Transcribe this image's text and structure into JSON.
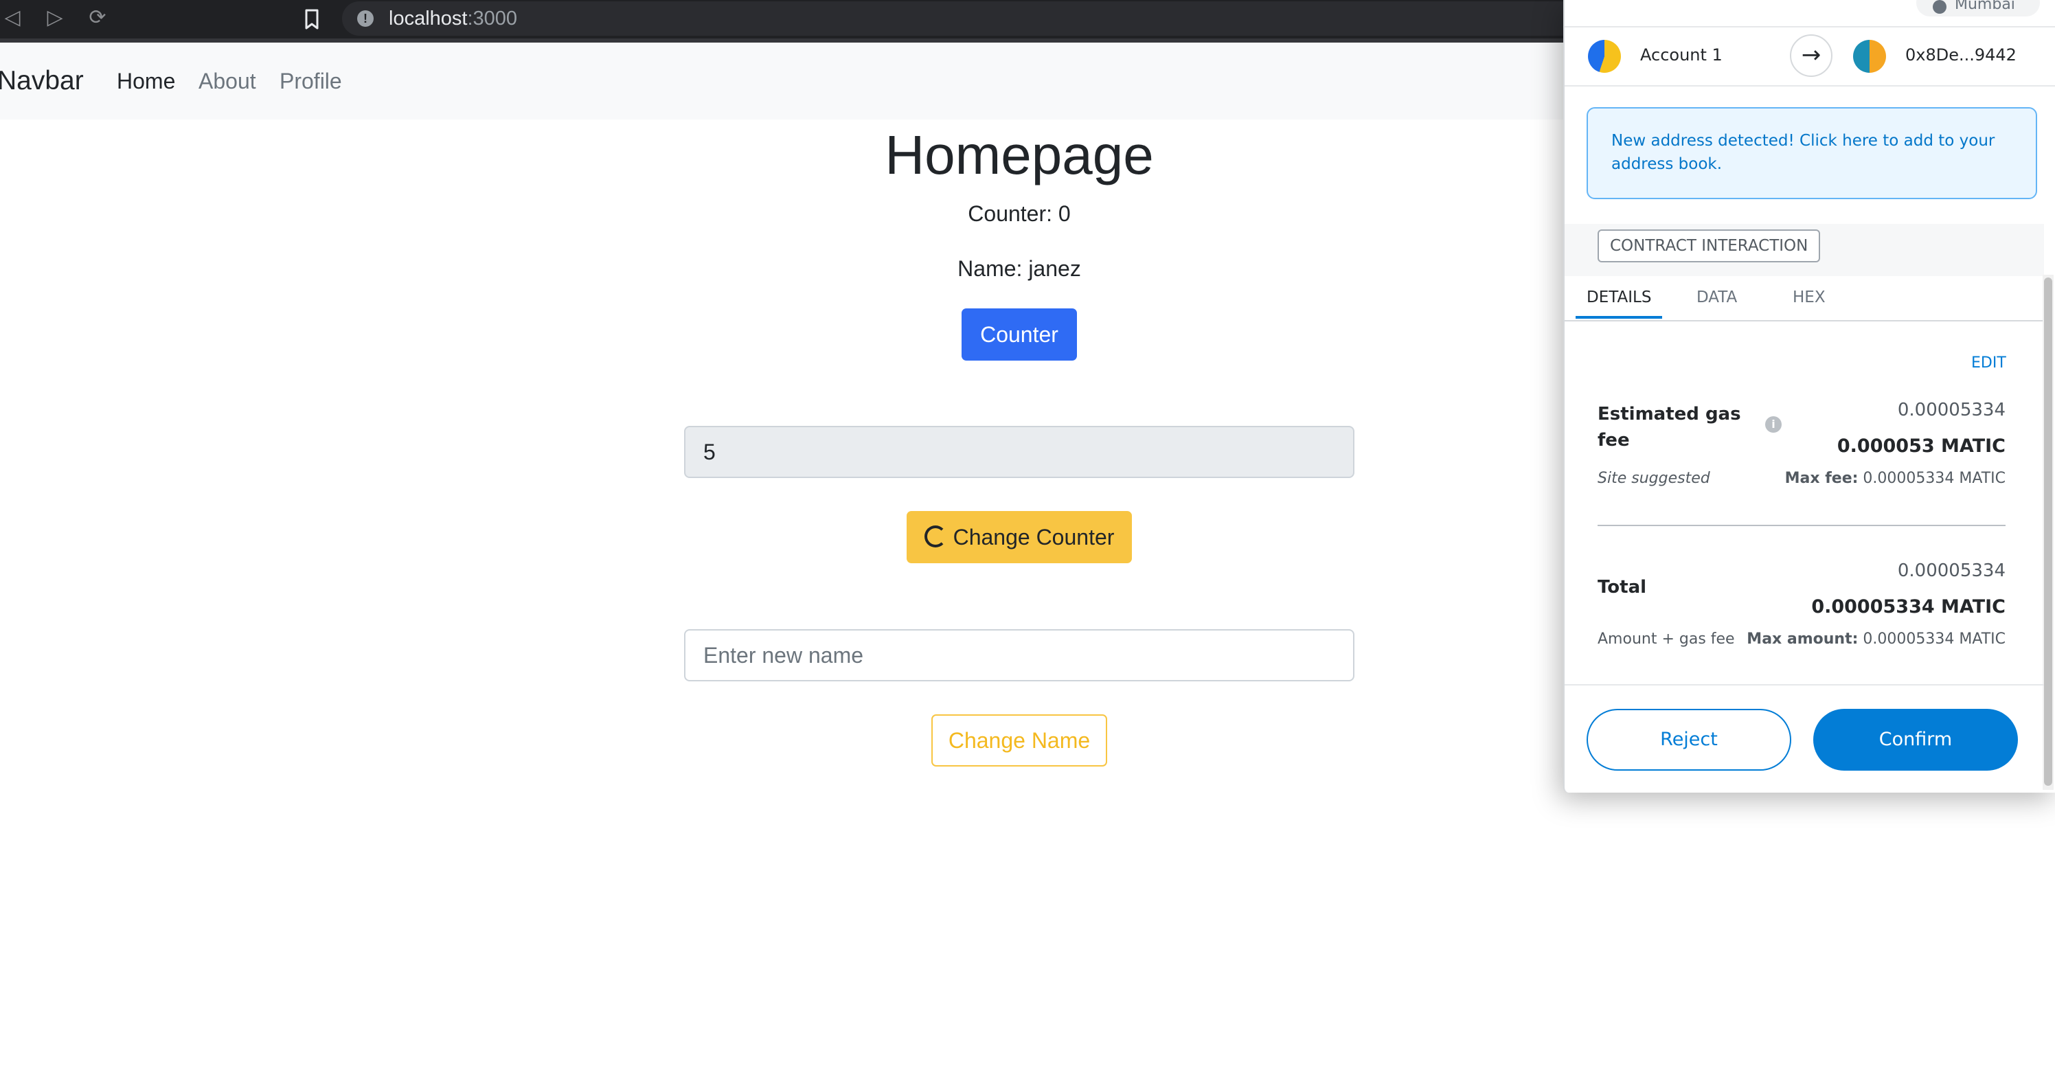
{
  "browser": {
    "url_host": "localhost",
    "url_port": ":3000",
    "icons": [
      "back-icon",
      "forward-icon",
      "reload-icon",
      "bookmark-icon",
      "site-info-icon"
    ]
  },
  "navbar": {
    "brand": "Navbar",
    "links": [
      "Home",
      "About",
      "Profile"
    ]
  },
  "main": {
    "title": "Homepage",
    "counter_text": "Counter: 0",
    "name_text": "Name: janez",
    "counter_button": "Counter",
    "counter_input_value": "5",
    "change_counter_button": "Change Counter",
    "name_input_placeholder": "Enter new name",
    "change_name_button": "Change Name"
  },
  "metamask": {
    "network": "Mumbai",
    "from_account": "Account 1",
    "to_address": "0x8De...9442",
    "notice": "New address detected! Click here to add to your address book.",
    "interaction_tag": "CONTRACT INTERACTION",
    "tabs": [
      "DETAILS",
      "DATA",
      "HEX"
    ],
    "edit": "EDIT",
    "gas_label": "Estimated gas fee",
    "gas_value_secondary": "0.00005334",
    "gas_value_primary": "0.000053 MATIC",
    "site_suggested": "Site suggested",
    "max_fee_label": "Max fee:",
    "max_fee_value": "0.00005334 MATIC",
    "total_label": "Total",
    "total_secondary": "0.00005334",
    "total_primary": "0.00005334 MATIC",
    "amount_gas_label": "Amount + gas fee",
    "max_amount_label": "Max amount:",
    "max_amount_value": "0.00005334 MATIC",
    "reject": "Reject",
    "confirm": "Confirm"
  },
  "colors": {
    "primary_button": "#2f6bf4",
    "warning_button": "#f8c543",
    "metamask_blue": "#037dd6"
  }
}
